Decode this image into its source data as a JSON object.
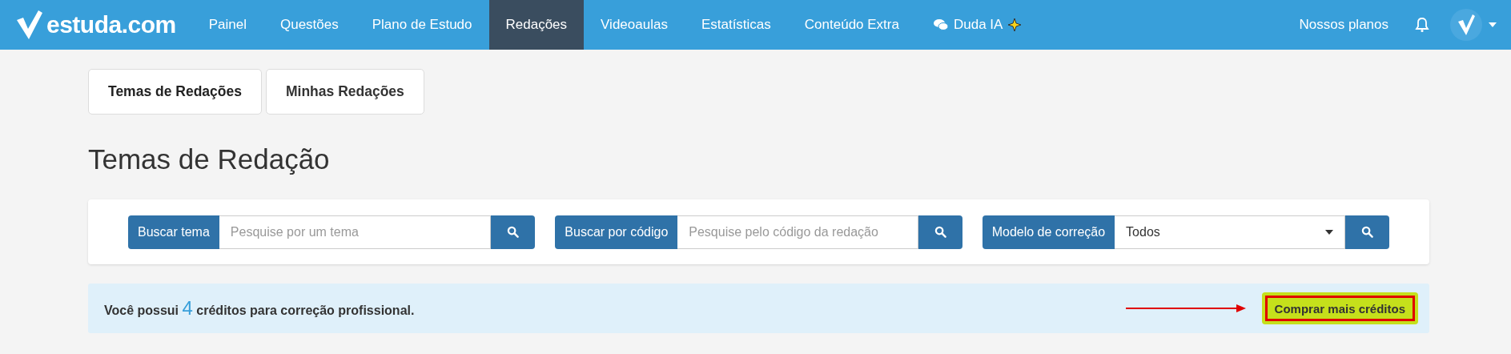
{
  "navbar": {
    "logo": "estuda.com",
    "items": [
      {
        "label": "Painel",
        "selected": false,
        "kind": "link"
      },
      {
        "label": "Questões",
        "selected": false,
        "kind": "link"
      },
      {
        "label": "Plano de Estudo",
        "selected": false,
        "kind": "link"
      },
      {
        "label": "Redações",
        "selected": true,
        "kind": "link"
      },
      {
        "label": "Videoaulas",
        "selected": false,
        "kind": "link"
      },
      {
        "label": "Estatísticas",
        "selected": false,
        "kind": "link"
      },
      {
        "label": "Conteúdo Extra",
        "selected": false,
        "kind": "link"
      },
      {
        "label": "Duda IA",
        "selected": false,
        "kind": "ai"
      }
    ],
    "right_link": "Nossos planos"
  },
  "tabs": [
    {
      "label": "Temas de Redações",
      "selected": true
    },
    {
      "label": "Minhas Redações",
      "selected": false
    }
  ],
  "title": "Temas de Redação",
  "filters": [
    {
      "kind": "text",
      "label": "Buscar tema",
      "placeholder": "Pesquise por um tema"
    },
    {
      "kind": "text",
      "label": "Buscar por código",
      "placeholder": "Pesquise pelo código da redação"
    },
    {
      "kind": "select",
      "label": "Modelo de correção",
      "value": "Todos"
    }
  ],
  "credits": {
    "prefix": "Você possui",
    "count": "4",
    "suffix": "créditos para correção profissional.",
    "button": {
      "label": "Comprar mais créditos",
      "annotated": true
    }
  }
}
